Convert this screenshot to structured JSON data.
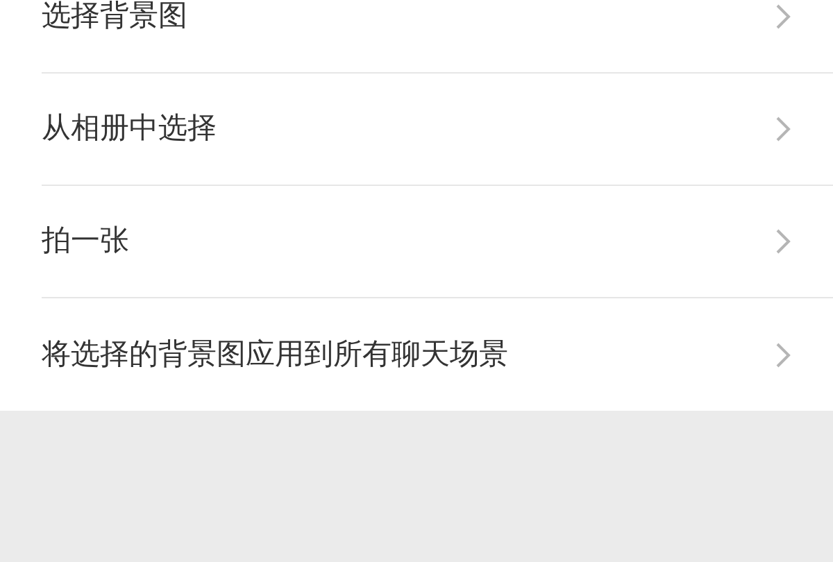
{
  "menu_items": [
    {
      "label": "选择背景图"
    },
    {
      "label": "从相册中选择"
    },
    {
      "label": "拍一张"
    },
    {
      "label": "将选择的背景图应用到所有聊天场景"
    }
  ]
}
